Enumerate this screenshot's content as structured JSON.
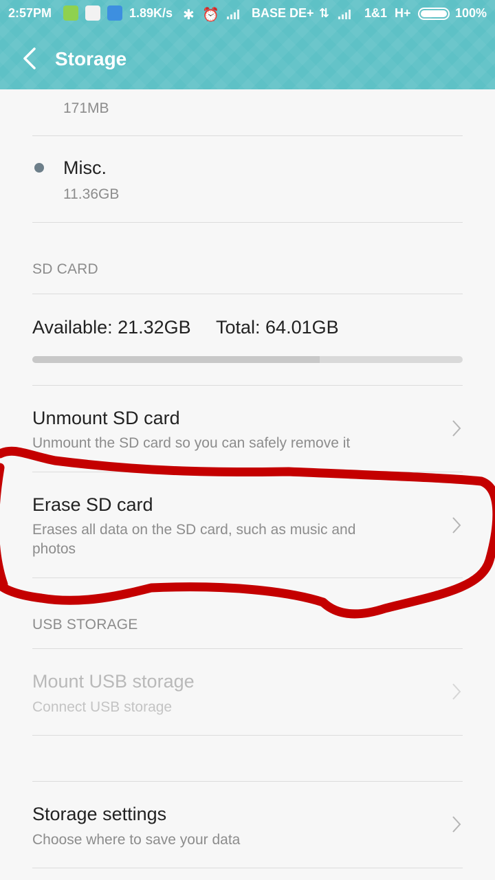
{
  "status_bar": {
    "time": "2:57PM",
    "speed": "1.89K/s",
    "carrier1": "BASE DE+",
    "carrier2": "1&1",
    "network2": "H+",
    "battery": "100%"
  },
  "action_bar": {
    "back_icon": "chevron-left-icon",
    "title": "Storage"
  },
  "partial_item": {
    "title_fragment": "··· ·· ····",
    "size": "171MB"
  },
  "misc": {
    "label": "Misc.",
    "size": "11.36GB",
    "dot_color": "#6d7f8a"
  },
  "sd_card": {
    "section_header": "SD CARD",
    "available_label": "Available: 21.32GB",
    "total_label": "Total: 64.01GB",
    "used_fraction": 0.667,
    "unmount": {
      "title": "Unmount SD card",
      "subtitle": "Unmount the SD card so you can safely remove it"
    },
    "erase": {
      "title": "Erase SD card",
      "subtitle_line1": "Erases all data on the SD card, such as music and",
      "subtitle_line2": "photos"
    }
  },
  "usb_storage": {
    "section_header": "USB STORAGE",
    "mount": {
      "title": "Mount USB storage",
      "subtitle": "Connect USB storage"
    }
  },
  "storage_settings": {
    "title": "Storage settings",
    "subtitle": "Choose where to save your data"
  },
  "colors": {
    "header": "#5ec1c6",
    "annotation": "#c40000"
  }
}
